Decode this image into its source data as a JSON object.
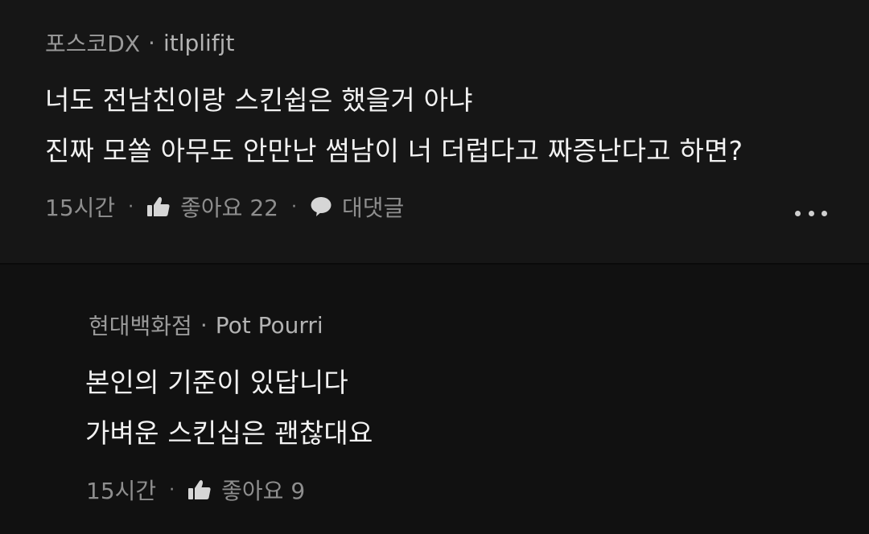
{
  "comments": [
    {
      "company": "포스코DX",
      "separator": "·",
      "username": "itlplifjt",
      "lines": [
        "너도 전남친이랑 스킨쉽은 했을거 아냐",
        "진짜 모쏠 아무도 안만난 썸남이 너 더럽다고 짜증난다고 하면?"
      ],
      "time": "15시간",
      "like_label": "좋아요 22",
      "reply_label": "대댓글",
      "dot": "·"
    },
    {
      "company": "현대백화점",
      "separator": "·",
      "username": "Pot Pourri",
      "lines": [
        "본인의 기준이 있답니다",
        "가벼운 스킨십은 괜찮대요"
      ],
      "time": "15시간",
      "like_label": "좋아요 9",
      "dot": "·"
    }
  ],
  "icons": {
    "like": "thumbs-up-icon",
    "reply": "speech-bubble-icon",
    "more": "more-horizontal-icon"
  },
  "colors": {
    "background_top": "#161616",
    "background_reply": "#111111",
    "text_primary": "#f2f2f2",
    "text_secondary": "#9a9a9a"
  }
}
